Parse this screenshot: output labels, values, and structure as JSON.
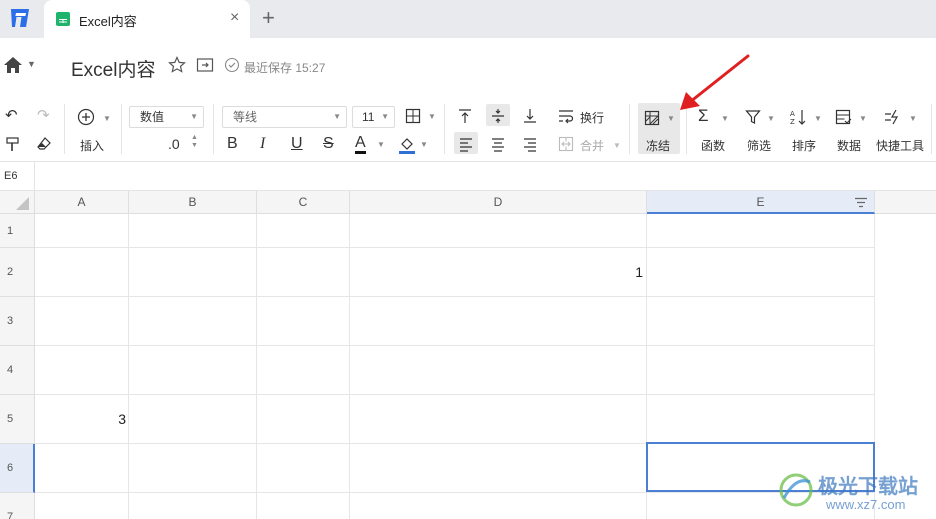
{
  "tab": {
    "title": "Excel内容",
    "close": "×",
    "new": "+"
  },
  "titlebar": {
    "doc_title": "Excel内容",
    "save_status": "最近保存 15:27"
  },
  "toolbar": {
    "insert_label": "插入",
    "number_format": "数值",
    "decimal": ".0",
    "font_name": "等线",
    "font_size": "11",
    "wrap_label": "换行",
    "merge_label": "合并",
    "freeze_label": "冻结",
    "function_label": "函数",
    "filter_label": "筛选",
    "sort_label": "排序",
    "data_label": "数据",
    "quicktools_label": "快捷工具",
    "bold": "B",
    "italic": "I",
    "underline": "U",
    "strike": "S",
    "font_color": "A"
  },
  "formula_bar": {
    "cell_ref": "E6"
  },
  "sheet": {
    "columns": [
      "A",
      "B",
      "C",
      "D",
      "E"
    ],
    "rows": [
      "1",
      "2",
      "3",
      "4",
      "5",
      "6",
      "7"
    ],
    "cells": {
      "D2": "1",
      "A5": "3"
    },
    "selected_cell": "E6"
  },
  "watermark": {
    "text": "极光下载站",
    "url": "www.xz7.com"
  },
  "colors": {
    "accent": "#4a7fd4",
    "arrow": "#e02020",
    "tab_icon": "#1fb36b"
  }
}
